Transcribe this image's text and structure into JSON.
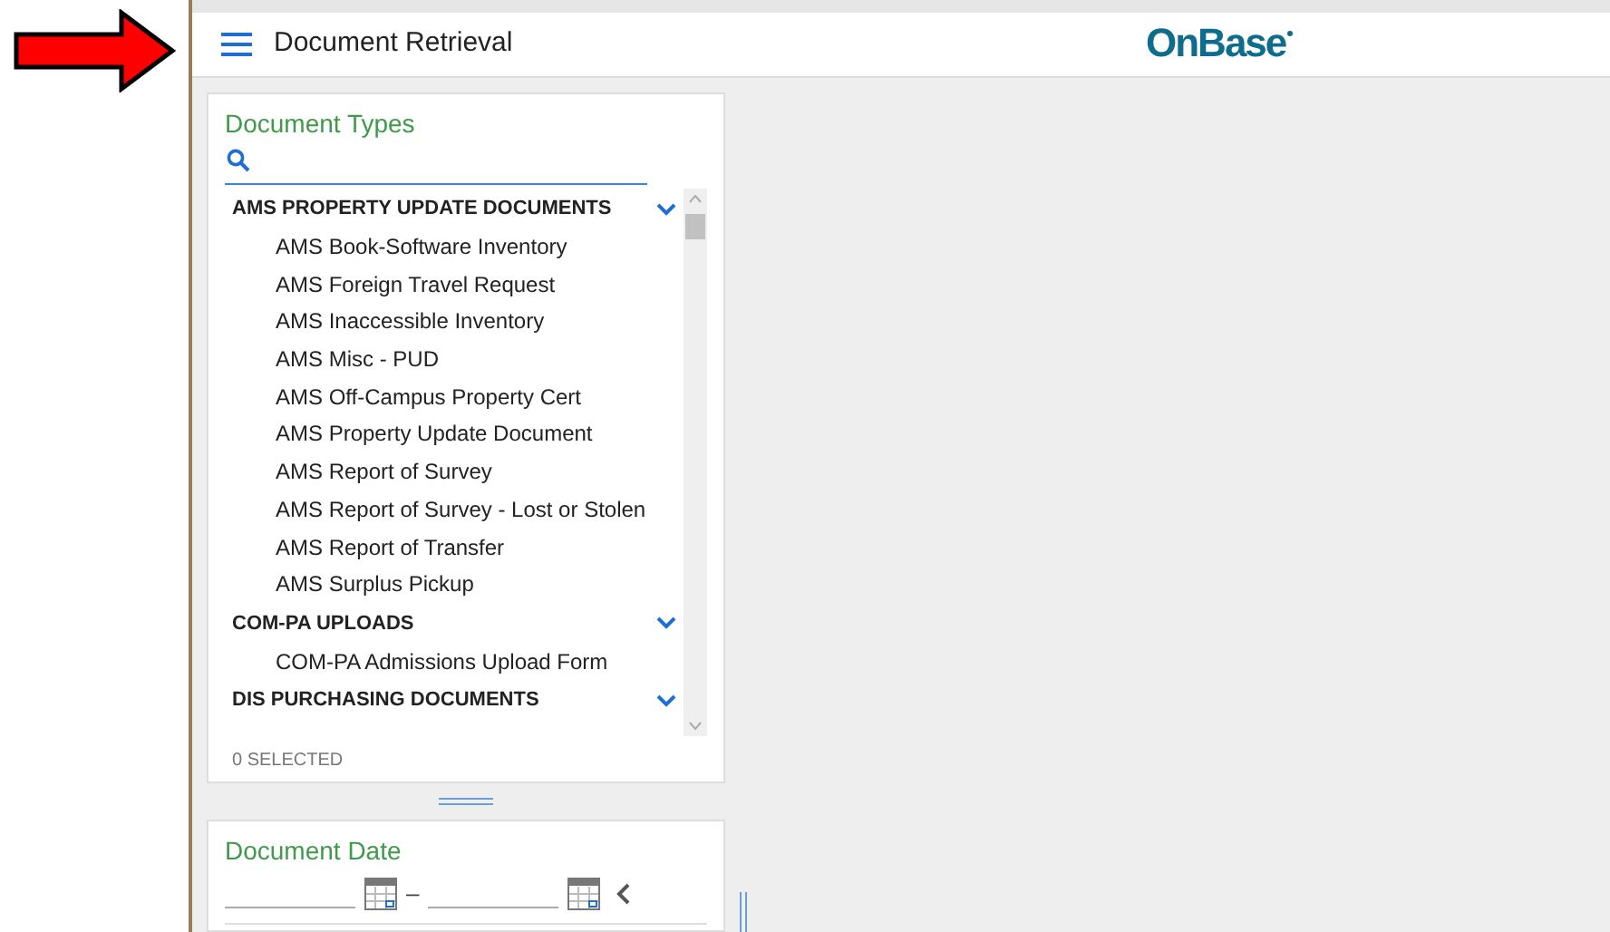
{
  "header": {
    "title": "Document Retrieval",
    "logo": "OnBase"
  },
  "document_types": {
    "title": "Document Types",
    "groups": [
      {
        "name": "AMS PROPERTY UPDATE DOCUMENTS",
        "expanded": true,
        "items": [
          "AMS Book-Software Inventory",
          "AMS Foreign Travel Request",
          "AMS Inaccessible Inventory",
          "AMS Misc - PUD",
          "AMS Off-Campus Property Cert",
          "AMS Property Update Document",
          "AMS Report of Survey",
          "AMS Report of Survey - Lost or Stolen",
          "AMS Report of Transfer",
          "AMS Surplus Pickup"
        ]
      },
      {
        "name": "COM-PA UPLOADS",
        "expanded": true,
        "items": [
          "COM-PA Admissions Upload Form"
        ]
      },
      {
        "name": "DIS PURCHASING DOCUMENTS",
        "expanded": true
      }
    ],
    "selected_count": "0 SELECTED"
  },
  "document_date": {
    "title": "Document Date",
    "separator": "–"
  }
}
